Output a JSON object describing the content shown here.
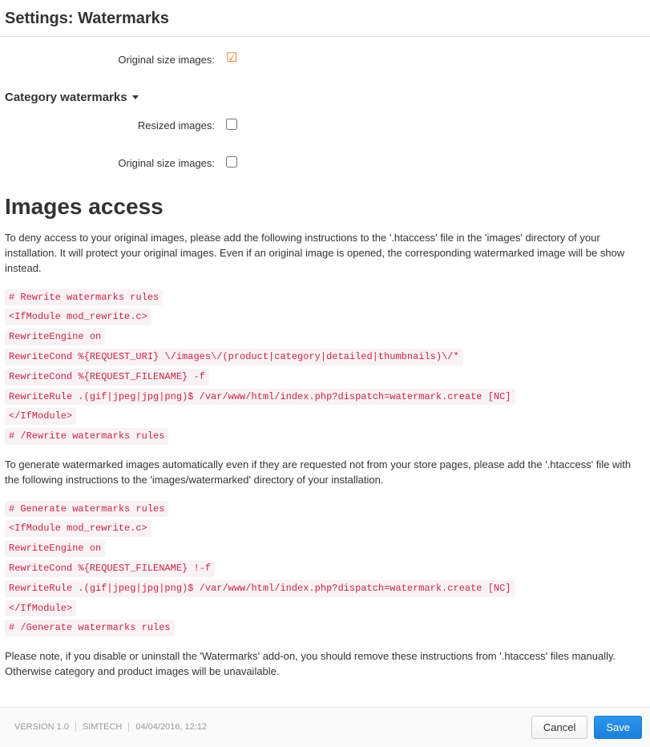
{
  "header": {
    "title": "Settings: Watermarks"
  },
  "top_form": {
    "original_size_label": "Original size images:",
    "original_size_checked": true
  },
  "category_section": {
    "title": "Category watermarks",
    "resized_label": "Resized images:",
    "resized_checked": false,
    "original_size_label": "Original size images:",
    "original_size_checked": false
  },
  "images_access": {
    "heading": "Images access",
    "para1": "To deny access to your original images, please add the following instructions to the '.htaccess' file in the 'images' directory of your installation. It will protect your original images. Even if an original image is opened, the corresponding watermarked image will be show instead.",
    "code1": [
      "# Rewrite watermarks rules",
      "<IfModule mod_rewrite.c>",
      "RewriteEngine on",
      "RewriteCond %{REQUEST_URI} \\/images\\/(product|category|detailed|thumbnails)\\/*",
      "RewriteCond %{REQUEST_FILENAME} -f",
      "RewriteRule .(gif|jpeg|jpg|png)$ /var/www/html/index.php?dispatch=watermark.create [NC]",
      "</IfModule>",
      "# /Rewrite watermarks rules"
    ],
    "para2": "To generate watermarked images automatically even if they are requested not from your store pages, please add the '.htaccess' file with the following instructions to the 'images/watermarked' directory of your installation.",
    "code2": [
      "# Generate watermarks rules",
      "<IfModule mod_rewrite.c>",
      "RewriteEngine on",
      "RewriteCond %{REQUEST_FILENAME} !-f",
      "RewriteRule .(gif|jpeg|jpg|png)$ /var/www/html/index.php?dispatch=watermark.create [NC]",
      "</IfModule>",
      "# /Generate watermarks rules"
    ],
    "para3": "Please note, if you disable or uninstall the 'Watermarks' add-on, you should remove these instructions from '.htaccess' files manually. Otherwise category and product images will be unavailable."
  },
  "footer": {
    "version": "VERSION 1.0",
    "vendor": "SIMTECH",
    "datetime": "04/04/2016, 12:12",
    "cancel_label": "Cancel",
    "save_label": "Save"
  }
}
